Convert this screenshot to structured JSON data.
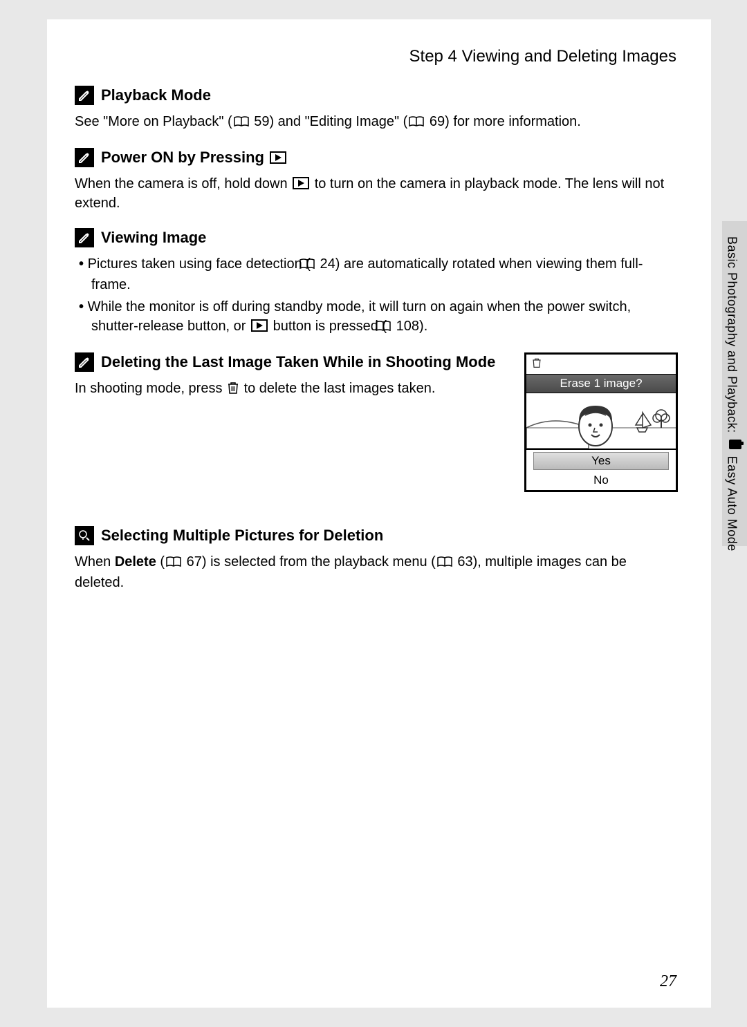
{
  "step_title": "Step 4 Viewing and Deleting Images",
  "sections": {
    "playback": {
      "title": "Playback Mode",
      "text_a": "See \"More on Playback\" (",
      "ref1": " 59) and \"Editing Image\" (",
      "ref2": " 69) for more information."
    },
    "poweron": {
      "title": "Power ON by Pressing ",
      "text_a": "When the camera is off, hold down ",
      "text_b": " to turn on the camera in playback mode. The lens will not extend."
    },
    "viewing": {
      "title": "Viewing Image",
      "bullet1_a": "Pictures taken using face detection (",
      "bullet1_b": " 24) are automatically rotated when viewing them full-frame.",
      "bullet2_a": "While the monitor is off during standby mode, it will turn on again when the power switch, shutter-release button, or ",
      "bullet2_b": " button is pressed (",
      "bullet2_c": " 108)."
    },
    "deleting": {
      "title": "Deleting the Last Image Taken While in Shooting Mode",
      "text_a": "In shooting mode, press ",
      "text_b": " to delete the last images taken."
    },
    "selecting": {
      "title": "Selecting Multiple Pictures for Deletion",
      "text_a": "When ",
      "bold": "Delete",
      "text_b": " (",
      "text_c": " 67) is selected from the playback menu (",
      "text_d": " 63), multiple images can be deleted."
    }
  },
  "camera_screen": {
    "prompt": "Erase 1 image?",
    "yes": "Yes",
    "no": "No"
  },
  "side_text_a": "Basic Photography and Playback: ",
  "side_text_b": " Easy Auto Mode",
  "page_number": "27"
}
